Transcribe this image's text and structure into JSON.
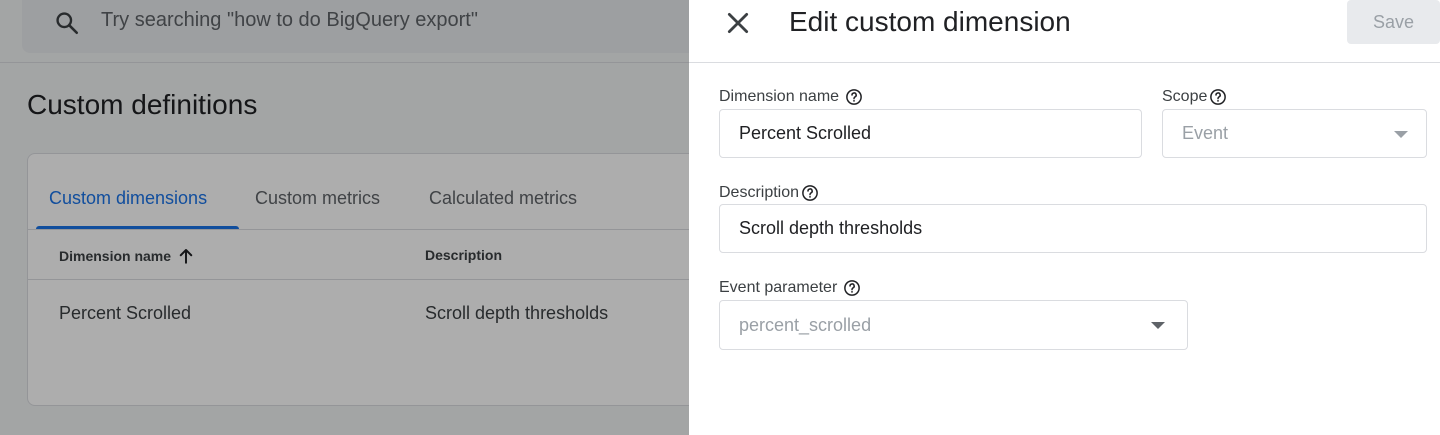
{
  "search": {
    "placeholder": "Try searching \"how to do BigQuery export\""
  },
  "page": {
    "title": "Custom definitions",
    "tabs": [
      {
        "label": "Custom dimensions",
        "active": true
      },
      {
        "label": "Custom metrics",
        "active": false
      },
      {
        "label": "Calculated metrics",
        "active": false
      }
    ],
    "table": {
      "columns": [
        "Dimension name",
        "Description"
      ],
      "sort_icon": "arrow-up-icon",
      "rows": [
        [
          "Percent Scrolled",
          "Scroll depth thresholds"
        ]
      ]
    }
  },
  "panel": {
    "title": "Edit custom dimension",
    "save_label": "Save",
    "close_icon": "close-icon",
    "dimension_name": {
      "label": "Dimension name",
      "value": "Percent Scrolled"
    },
    "scope": {
      "label": "Scope",
      "value": "Event"
    },
    "description": {
      "label": "Description",
      "value": "Scroll depth thresholds"
    },
    "event_parameter": {
      "label": "Event parameter",
      "value": "percent_scrolled"
    }
  },
  "colors": {
    "accent": "#1a73e8",
    "scrim": "rgba(0,0,0,0.32)",
    "disabled_text": "#9aa0a6"
  }
}
